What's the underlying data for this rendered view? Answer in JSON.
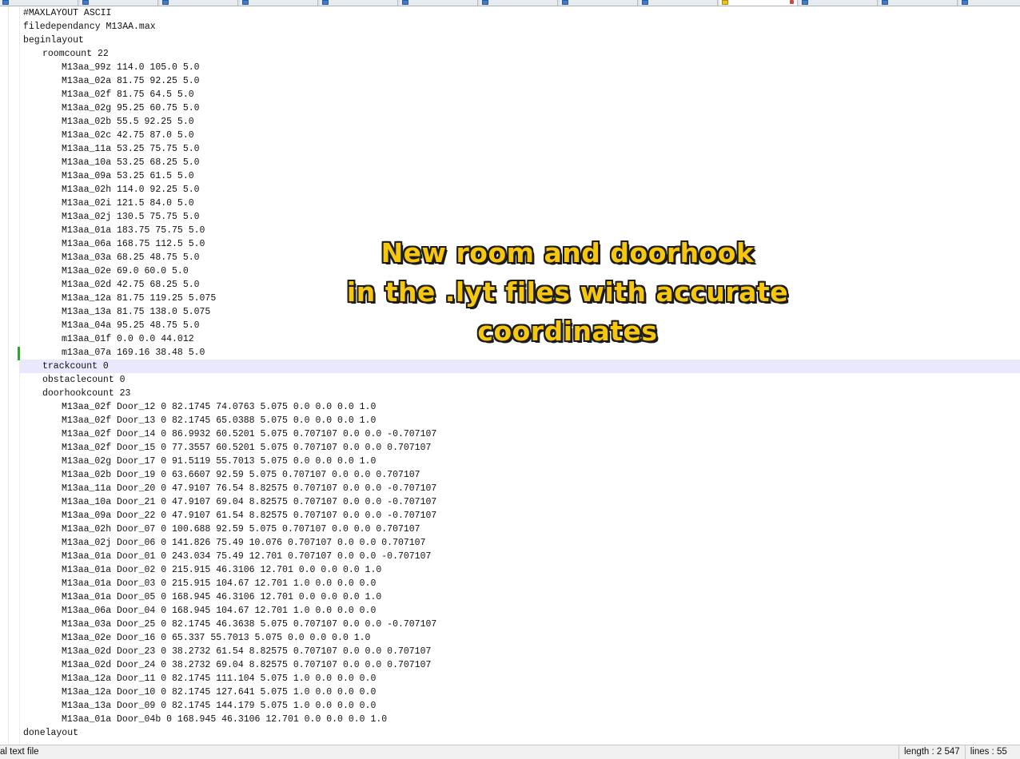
{
  "colors": {
    "annotation_fill": "#f7c70f",
    "annotation_outline": "#1c1c1c",
    "current_line": "#e8e8ff",
    "change_marker": "#2fa52f"
  },
  "editor": {
    "current_line_index": 26,
    "lines": [
      {
        "indent": 0,
        "text": "#MAXLAYOUT ASCII"
      },
      {
        "indent": 0,
        "text": "filedependancy M13AA.max"
      },
      {
        "indent": 0,
        "text": "beginlayout"
      },
      {
        "indent": 1,
        "text": "roomcount 22"
      },
      {
        "indent": 2,
        "text": "M13aa_99z 114.0 105.0 5.0"
      },
      {
        "indent": 2,
        "text": "M13aa_02a 81.75 92.25 5.0"
      },
      {
        "indent": 2,
        "text": "M13aa_02f 81.75 64.5 5.0"
      },
      {
        "indent": 2,
        "text": "M13aa_02g 95.25 60.75 5.0"
      },
      {
        "indent": 2,
        "text": "M13aa_02b 55.5 92.25 5.0"
      },
      {
        "indent": 2,
        "text": "M13aa_02c 42.75 87.0 5.0"
      },
      {
        "indent": 2,
        "text": "M13aa_11a 53.25 75.75 5.0"
      },
      {
        "indent": 2,
        "text": "M13aa_10a 53.25 68.25 5.0"
      },
      {
        "indent": 2,
        "text": "M13aa_09a 53.25 61.5 5.0"
      },
      {
        "indent": 2,
        "text": "M13aa_02h 114.0 92.25 5.0"
      },
      {
        "indent": 2,
        "text": "M13aa_02i 121.5 84.0 5.0"
      },
      {
        "indent": 2,
        "text": "M13aa_02j 130.5 75.75 5.0"
      },
      {
        "indent": 2,
        "text": "M13aa_01a 183.75 75.75 5.0"
      },
      {
        "indent": 2,
        "text": "M13aa_06a 168.75 112.5 5.0"
      },
      {
        "indent": 2,
        "text": "M13aa_03a 68.25 48.75 5.0"
      },
      {
        "indent": 2,
        "text": "M13aa_02e 69.0 60.0 5.0"
      },
      {
        "indent": 2,
        "text": "M13aa_02d 42.75 68.25 5.0"
      },
      {
        "indent": 2,
        "text": "M13aa_12a 81.75 119.25 5.075"
      },
      {
        "indent": 2,
        "text": "M13aa_13a 81.75 138.0 5.075"
      },
      {
        "indent": 2,
        "text": "M13aa_04a 95.25 48.75 5.0"
      },
      {
        "indent": 2,
        "text": "m13aa_01f 0.0 0.0 44.012"
      },
      {
        "indent": 2,
        "text": "m13aa_07a 169.16 38.48 5.0"
      },
      {
        "indent": 1,
        "text": "trackcount 0"
      },
      {
        "indent": 1,
        "text": "obstaclecount 0"
      },
      {
        "indent": 1,
        "text": "doorhookcount 23"
      },
      {
        "indent": 2,
        "text": "M13aa_02f Door_12 0 82.1745 74.0763 5.075 0.0 0.0 0.0 1.0"
      },
      {
        "indent": 2,
        "text": "M13aa_02f Door_13 0 82.1745 65.0388 5.075 0.0 0.0 0.0 1.0"
      },
      {
        "indent": 2,
        "text": "M13aa_02f Door_14 0 86.9932 60.5201 5.075 0.707107 0.0 0.0 -0.707107"
      },
      {
        "indent": 2,
        "text": "M13aa_02f Door_15 0 77.3557 60.5201 5.075 0.707107 0.0 0.0 0.707107"
      },
      {
        "indent": 2,
        "text": "M13aa_02g Door_17 0 91.5119 55.7013 5.075 0.0 0.0 0.0 1.0"
      },
      {
        "indent": 2,
        "text": "M13aa_02b Door_19 0 63.6607 92.59 5.075 0.707107 0.0 0.0 0.707107"
      },
      {
        "indent": 2,
        "text": "M13aa_11a Door_20 0 47.9107 76.54 8.82575 0.707107 0.0 0.0 -0.707107"
      },
      {
        "indent": 2,
        "text": "M13aa_10a Door_21 0 47.9107 69.04 8.82575 0.707107 0.0 0.0 -0.707107"
      },
      {
        "indent": 2,
        "text": "M13aa_09a Door_22 0 47.9107 61.54 8.82575 0.707107 0.0 0.0 -0.707107"
      },
      {
        "indent": 2,
        "text": "M13aa_02h Door_07 0 100.688 92.59 5.075 0.707107 0.0 0.0 0.707107"
      },
      {
        "indent": 2,
        "text": "M13aa_02j Door_06 0 141.826 75.49 10.076 0.707107 0.0 0.0 0.707107"
      },
      {
        "indent": 2,
        "text": "M13aa_01a Door_01 0 243.034 75.49 12.701 0.707107 0.0 0.0 -0.707107"
      },
      {
        "indent": 2,
        "text": "M13aa_01a Door_02 0 215.915 46.3106 12.701 0.0 0.0 0.0 1.0"
      },
      {
        "indent": 2,
        "text": "M13aa_01a Door_03 0 215.915 104.67 12.701 1.0 0.0 0.0 0.0"
      },
      {
        "indent": 2,
        "text": "M13aa_01a Door_05 0 168.945 46.3106 12.701 0.0 0.0 0.0 1.0"
      },
      {
        "indent": 2,
        "text": "M13aa_06a Door_04 0 168.945 104.67 12.701 1.0 0.0 0.0 0.0"
      },
      {
        "indent": 2,
        "text": "M13aa_03a Door_25 0 82.1745 46.3638 5.075 0.707107 0.0 0.0 -0.707107"
      },
      {
        "indent": 2,
        "text": "M13aa_02e Door_16 0 65.337 55.7013 5.075 0.0 0.0 0.0 1.0"
      },
      {
        "indent": 2,
        "text": "M13aa_02d Door_23 0 38.2732 61.54 8.82575 0.707107 0.0 0.0 0.707107"
      },
      {
        "indent": 2,
        "text": "M13aa_02d Door_24 0 38.2732 69.04 8.82575 0.707107 0.0 0.0 0.707107"
      },
      {
        "indent": 2,
        "text": "M13aa_12a Door_11 0 82.1745 111.104 5.075 1.0 0.0 0.0 0.0"
      },
      {
        "indent": 2,
        "text": "M13aa_12a Door_10 0 82.1745 127.641 5.075 1.0 0.0 0.0 0.0"
      },
      {
        "indent": 2,
        "text": "M13aa_13a Door_09 0 82.1745 144.179 5.075 1.0 0.0 0.0 0.0"
      },
      {
        "indent": 2,
        "text": "M13aa_01a Door_04b 0 168.945 46.3106 12.701 0.0 0.0 0.0 1.0"
      },
      {
        "indent": 0,
        "text": "donelayout"
      }
    ]
  },
  "annotation": {
    "lines": [
      "New room and doorhook",
      "in the .lyt files with accurate",
      "coordinates"
    ]
  },
  "statusbar": {
    "file_type": "al text file",
    "length": "length : 2 547",
    "lines": "lines : 55"
  }
}
